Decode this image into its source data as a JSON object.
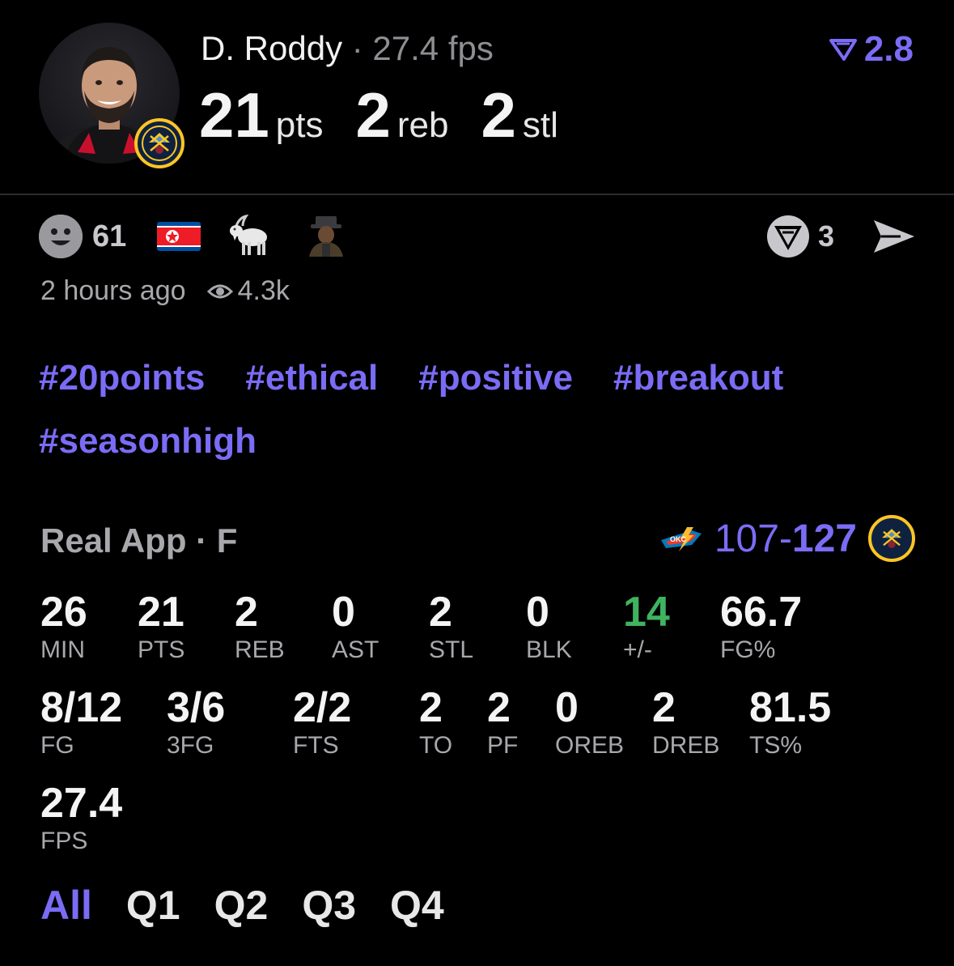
{
  "header": {
    "player_name": "D. Roddy",
    "separator": " · ",
    "player_fps": "27.4 fps",
    "rating": "2.8",
    "big_stats": [
      {
        "value": "21",
        "unit": "pts"
      },
      {
        "value": "2",
        "unit": "reb"
      },
      {
        "value": "2",
        "unit": "stl"
      }
    ]
  },
  "reactions": {
    "count": "61",
    "share_count": "3"
  },
  "meta": {
    "time": "2 hours ago",
    "views": "4.3k"
  },
  "tags": [
    "#20points",
    "#ethical",
    "#positive",
    "#breakout",
    "#seasonhigh"
  ],
  "game": {
    "source": "Real App · F",
    "score_away": "107",
    "score_dash": "-",
    "score_home": "127"
  },
  "stats": {
    "min": {
      "v": "26",
      "l": "MIN"
    },
    "pts": {
      "v": "21",
      "l": "PTS"
    },
    "reb": {
      "v": "2",
      "l": "REB"
    },
    "ast": {
      "v": "0",
      "l": "AST"
    },
    "stl": {
      "v": "2",
      "l": "STL"
    },
    "blk": {
      "v": "0",
      "l": "BLK"
    },
    "pm": {
      "v": "14",
      "l": "+/-"
    },
    "fgp": {
      "v": "66.7",
      "l": "FG%"
    },
    "fg": {
      "v": "8/12",
      "l": "FG"
    },
    "tfg": {
      "v": "3/6",
      "l": "3FG"
    },
    "fts": {
      "v": "2/2",
      "l": "FTS"
    },
    "to": {
      "v": "2",
      "l": "TO"
    },
    "pf": {
      "v": "2",
      "l": "PF"
    },
    "oreb": {
      "v": "0",
      "l": "OREB"
    },
    "dreb": {
      "v": "2",
      "l": "DREB"
    },
    "ts": {
      "v": "81.5",
      "l": "TS%"
    },
    "fps": {
      "v": "27.4",
      "l": "FPS"
    }
  },
  "tabs": [
    "All",
    "Q1",
    "Q2",
    "Q3",
    "Q4"
  ],
  "colors": {
    "accent": "#7b6cf6",
    "positive": "#3fb35f",
    "muted": "#a8a8ac",
    "background": "#000000"
  },
  "icons": [
    "player-avatar",
    "nuggets-logo-icon",
    "rating-arrow-icon",
    "smiley-icon",
    "north-korea-flag-icon",
    "goat-icon",
    "person-emoji-icon",
    "reshare-icon",
    "send-icon",
    "eye-icon",
    "thunder-logo-icon"
  ]
}
